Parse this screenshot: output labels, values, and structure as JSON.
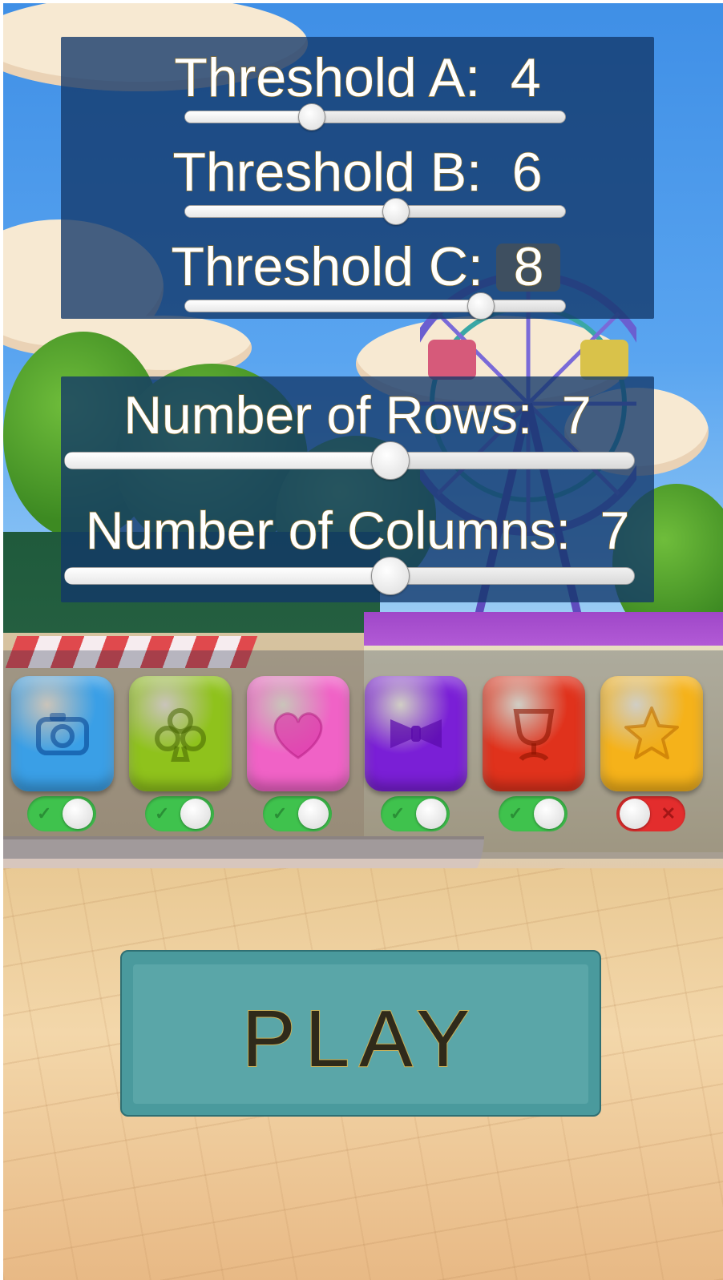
{
  "thresholds": [
    {
      "label": "Threshold A:  4",
      "value": 4,
      "min": 1,
      "max": 10
    },
    {
      "label": "Threshold B:  6",
      "value": 6,
      "min": 1,
      "max": 10
    },
    {
      "label": "Threshold C:  8",
      "value": 8,
      "min": 1,
      "max": 10
    }
  ],
  "grid": {
    "rows": {
      "label": "Number of Rows:  7",
      "value": 7,
      "min": 3,
      "max": 10
    },
    "columns": {
      "label": "Number of Columns:  7",
      "value": 7,
      "min": 3,
      "max": 10
    }
  },
  "gems": [
    {
      "icon": "camera-icon",
      "color": "#3a9fe6",
      "enabled": true
    },
    {
      "icon": "club-icon",
      "color": "#8fc21c",
      "enabled": true
    },
    {
      "icon": "heart-icon",
      "color": "#f062c6",
      "enabled": true
    },
    {
      "icon": "bow-icon",
      "color": "#7a1fd6",
      "enabled": true
    },
    {
      "icon": "cup-icon",
      "color": "#e0321c",
      "enabled": true
    },
    {
      "icon": "star-icon",
      "color": "#f5b21a",
      "enabled": false
    }
  ],
  "play": {
    "label": "PLAY"
  }
}
